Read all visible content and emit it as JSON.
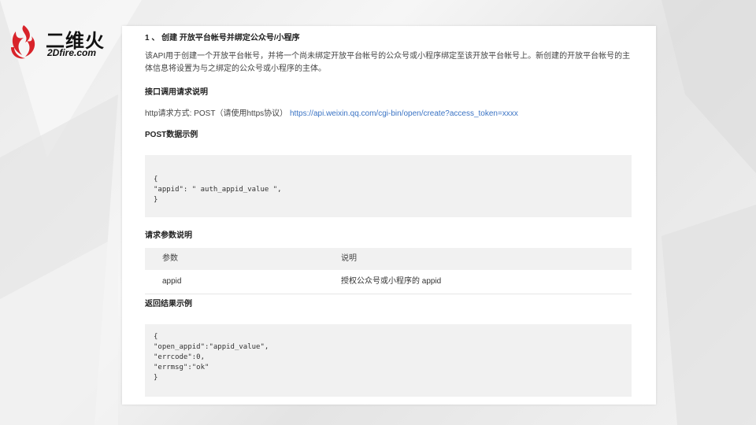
{
  "logo": {
    "cn": "二维火",
    "en": "2Dfire.com"
  },
  "doc": {
    "title": "1 、 创建 开放平台帐号并绑定公众号/小程序",
    "intro": "该API用于创建一个开放平台帐号，并将一个尚未绑定开放平台帐号的公众号或小程序绑定至该开放平台帐号上。新创建的开放平台帐号的主体信息将设置为与之绑定的公众号或小程序的主体。",
    "request_heading": "接口调用请求说明",
    "http_method_label": "http请求方式: POST（请使用https协议）",
    "http_url": "https://api.weixin.qq.com/cgi-bin/open/create?access_token=xxxx",
    "post_heading": "POST数据示例",
    "post_lines": [
      "{",
      "\"appid\": \" auth_appid_value \",",
      "}"
    ],
    "params_heading": "请求参数说明",
    "params_table": {
      "headers": [
        "参数",
        "说明"
      ],
      "rows": [
        {
          "param": "appid",
          "desc": "授权公众号或小程序的 appid"
        }
      ]
    },
    "result_heading": "返回结果示例",
    "result_lines": [
      "{",
      "\"open_appid\":\"appid_value\",",
      "\"errcode\":0,",
      "\"errmsg\":\"ok\"",
      "}"
    ]
  }
}
